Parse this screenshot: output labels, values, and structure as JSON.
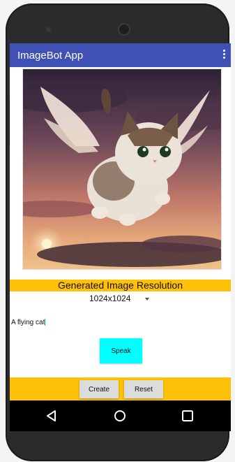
{
  "app": {
    "title": "ImageBot App"
  },
  "image": {
    "description_icon": "generated-image"
  },
  "resolution": {
    "label": "Generated Image Resolution",
    "selected": "1024x1024"
  },
  "prompt": {
    "value": "A flying cat"
  },
  "buttons": {
    "speak": "Speak",
    "create": "Create",
    "reset": "Reset"
  },
  "colors": {
    "appbar": "#3f51b5",
    "accent_band": "#ffc107",
    "speak_button": "#00ffff"
  },
  "navbar": {
    "icons": [
      "back-icon",
      "home-icon",
      "recents-icon"
    ]
  }
}
